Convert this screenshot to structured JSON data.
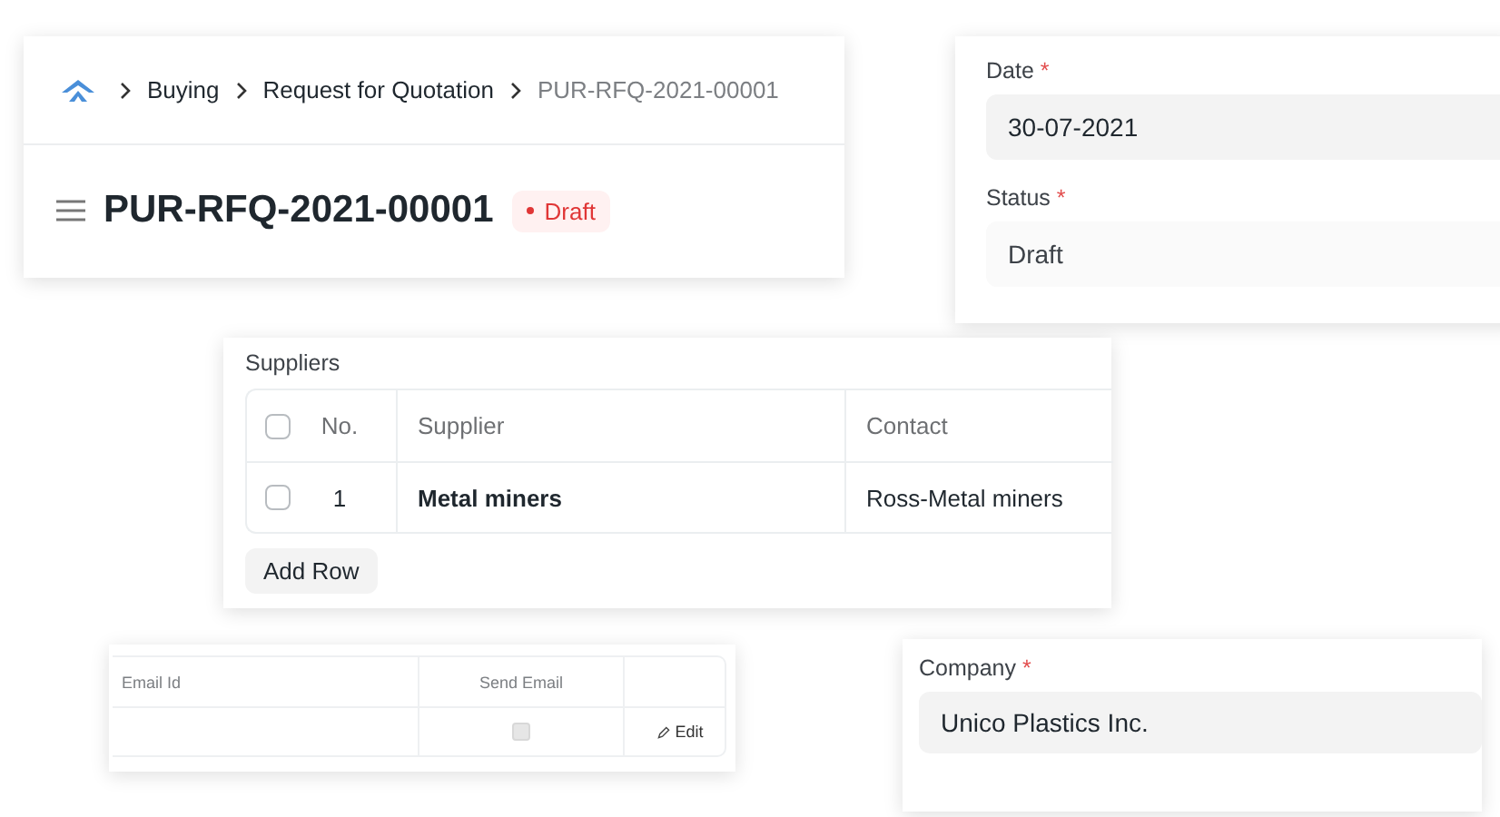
{
  "header_card": {
    "breadcrumbs": [
      {
        "label": "Buying",
        "current": false
      },
      {
        "label": "Request for Quotation",
        "current": false
      },
      {
        "label": "PUR-RFQ-2021-00001",
        "current": true
      }
    ],
    "title": "PUR-RFQ-2021-00001",
    "status_badge": "Draft"
  },
  "details_card": {
    "fields": [
      {
        "label": "Date",
        "required_mark": "*",
        "value": "30-07-2021",
        "read_only": false
      },
      {
        "label": "Status",
        "required_mark": "*",
        "value": "Draft",
        "read_only": true
      }
    ]
  },
  "suppliers": {
    "title": "Suppliers",
    "columns": [
      "No.",
      "Supplier",
      "Contact"
    ],
    "header_checked": false,
    "rows": [
      {
        "checked": false,
        "no": "1",
        "supplier": "Metal miners",
        "contact": "Ross-Metal miners"
      }
    ],
    "add_button": "Add Row"
  },
  "email_table": {
    "columns": [
      "Email Id",
      "Send Email"
    ],
    "rows": [
      {
        "email": "",
        "send_email": false,
        "action": "Edit"
      }
    ]
  },
  "company_card": {
    "label": "Company",
    "required_mark": "*",
    "value": "Unico Plastics Inc."
  }
}
